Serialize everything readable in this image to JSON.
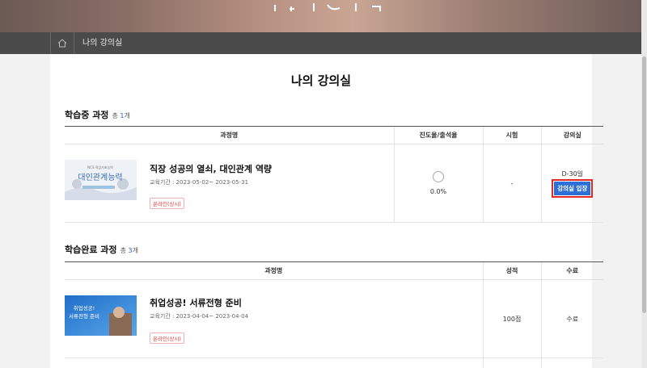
{
  "breadcrumb": {
    "home_icon": "home-icon",
    "current": "나의 강의실"
  },
  "page": {
    "title": "나의 강의실"
  },
  "in_progress": {
    "title": "학습중 과정",
    "count_prefix": "총 ",
    "count": "1",
    "count_suffix": "개",
    "headers": [
      "과정명",
      "진도율/출석율",
      "시험",
      "강의실"
    ],
    "courses": [
      {
        "thumb_small": "NCS 직업기초능력",
        "thumb_big": "대인관계능력",
        "name": "직장 성공의 열쇠, 대인관계 역량",
        "period": "교육기간 : 2023-05-02~ 2023-05-31",
        "tag": "온라인(상시)",
        "progress": "0.0%",
        "exam": "-",
        "dday": "D-30일",
        "enter_label": "강의실 입장"
      }
    ]
  },
  "completed": {
    "title": "학습완료 과정",
    "count_prefix": "총 ",
    "count": "3",
    "count_suffix": "개",
    "headers": [
      "과정명",
      "성적",
      "수료"
    ],
    "courses": [
      {
        "thumb_line1": "취업성공!",
        "thumb_line2": "서류전형 준비",
        "name": "취업성공! 서류전형 준비",
        "period": "교육기간 : 2023-04-04~ 2023-04-04",
        "tag": "온라인(상시)",
        "score": "100점",
        "status": "수료"
      }
    ]
  },
  "colors": {
    "accent": "#2c6fd6",
    "highlight": "#e42727",
    "tag": "#e03a3a"
  }
}
